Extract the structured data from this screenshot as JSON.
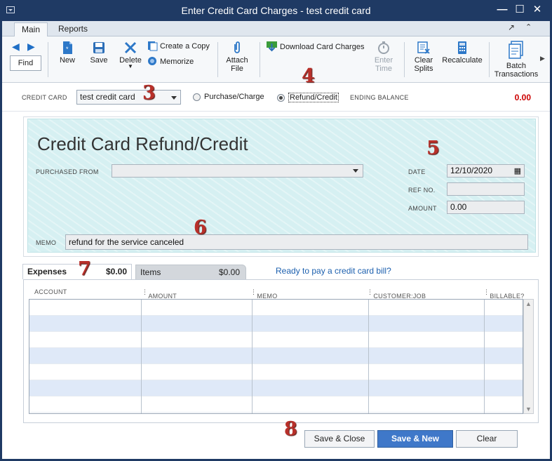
{
  "window": {
    "title": "Enter Credit Card Charges - test credit card"
  },
  "ribbon": {
    "tabs": [
      {
        "label": "Main"
      },
      {
        "label": "Reports"
      }
    ]
  },
  "toolbar": {
    "find": "Find",
    "new": "New",
    "save": "Save",
    "delete": "Delete",
    "create_copy": "Create a Copy",
    "memorize": "Memorize",
    "attach_file": [
      "Attach",
      "File"
    ],
    "download_card_charges": "Download Card Charges",
    "enter_time": [
      "Enter",
      "Time"
    ],
    "clear_splits": [
      "Clear",
      "Splits"
    ],
    "recalculate": "Recalculate",
    "batch_transactions": [
      "Batch",
      "Transactions"
    ]
  },
  "header": {
    "credit_card_label": "CREDIT CARD",
    "credit_card_value": "test credit card",
    "radio_purchase": "Purchase/Charge",
    "radio_refund": "Refund/Credit",
    "selected_radio": "Refund/Credit",
    "ending_balance_label": "ENDING BALANCE",
    "ending_balance_value": "0.00"
  },
  "form": {
    "title": "Credit Card Refund/Credit",
    "purchased_from_label": "PURCHASED FROM",
    "purchased_from_value": "",
    "date_label": "DATE",
    "date_value": "12/10/2020",
    "ref_no_label": "REF NO.",
    "ref_no_value": "",
    "amount_label": "AMOUNT",
    "amount_value": "0.00",
    "memo_label": "MEMO",
    "memo_value": "refund for the service canceled"
  },
  "detail_tabs": {
    "expenses_label": "Expenses",
    "expenses_amount": "$0.00",
    "items_label": "Items",
    "items_amount": "$0.00",
    "link": "Ready to pay a credit card bill?"
  },
  "grid": {
    "columns": [
      "ACCOUNT",
      "AMOUNT",
      "MEMO",
      "CUSTOMER:JOB",
      "BILLABLE?"
    ]
  },
  "footer": {
    "save_close": "Save & Close",
    "save_new": "Save & New",
    "clear": "Clear"
  },
  "annotations": [
    "3",
    "4",
    "5",
    "6",
    "7",
    "8"
  ],
  "colors": {
    "titlebar": "#1f3a64",
    "form_panel": "#d6f0f2",
    "primary_button": "#3f78c9",
    "balance_red": "#cc0000",
    "annotation_red": "#b8302a"
  }
}
